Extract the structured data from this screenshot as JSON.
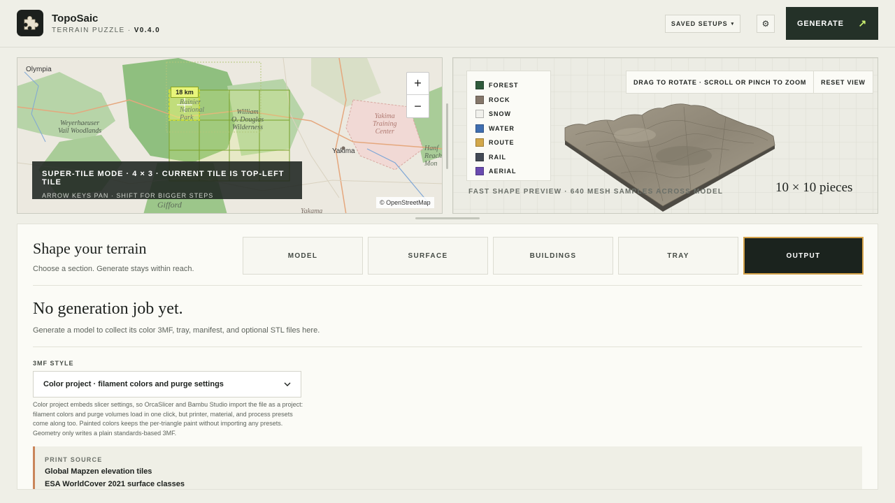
{
  "header": {
    "app_name": "TopoSaic",
    "app_subtitle": "TERRAIN PUZZLE ·",
    "version": "V0.4.0",
    "saved_setups_label": "SAVED SETUPS",
    "saved_setups_caret": "▾",
    "settings_icon": "gear-icon",
    "settings_glyph": "⚙",
    "generate_label": "GENERATE",
    "generate_arrow": "↗"
  },
  "map": {
    "zoom_in": "+",
    "zoom_out": "−",
    "scale_label": "18 km",
    "mode_title": "SUPER-TILE MODE · 4 × 3 · CURRENT TILE IS TOP-LEFT TILE",
    "mode_hint": "ARROW KEYS PAN · SHIFT FOR BIGGER STEPS",
    "attribution": "© OpenStreetMap",
    "labels": {
      "olympia": "Olympia",
      "weyerhaeuser": "Weyerhaeuser\nVail Woodlands",
      "william_douglas": "William\nO. Douglas\nWilderness",
      "rainier": "Rainier\nNational\nPark",
      "yakima_training": "Yakima\nTraining\nCenter",
      "yakima": "Yakima",
      "gifford": "Gifford",
      "yakama": "Yakama",
      "hanford": "Hanf\nReach N\nMon"
    }
  },
  "preview": {
    "legend": [
      {
        "label": "FOREST",
        "color": "#2f5a3b"
      },
      {
        "label": "ROCK",
        "color": "#85776a"
      },
      {
        "label": "SNOW",
        "color": "#f1f1ec"
      },
      {
        "label": "WATER",
        "color": "#3f6eb0"
      },
      {
        "label": "ROUTE",
        "color": "#d3a84a"
      },
      {
        "label": "RAIL",
        "color": "#434a55"
      },
      {
        "label": "AERIAL",
        "color": "#6a4bb0"
      }
    ],
    "view_hint": "DRAG TO ROTATE · SCROLL OR PINCH TO ZOOM",
    "reset_view": "RESET VIEW",
    "note": "FAST SHAPE PREVIEW · 640 MESH SAMPLES ACROSS MODEL",
    "pieces": "10 × 10 pieces"
  },
  "shape": {
    "title": "Shape your terrain",
    "subtitle": "Choose a section. Generate stays within reach.",
    "tabs": [
      "MODEL",
      "SURFACE",
      "BUILDINGS",
      "TRAY",
      "OUTPUT"
    ],
    "active_tab": "OUTPUT"
  },
  "output": {
    "heading": "No generation job yet.",
    "subheading": "Generate a model to collect its color 3MF, tray, manifest, and optional STL files here.",
    "style_label": "3MF STYLE",
    "style_value": "Color project · filament colors and purge settings",
    "style_description": "Color project embeds slicer settings, so OrcaSlicer and Bambu Studio import the file as a project: filament colors and purge volumes load in one click, but printer, material, and process presets come along too. Painted colors keeps the per-triangle paint without importing any presets. Geometry only writes a plain standards-based 3MF.",
    "print_source_label": "PRINT SOURCE",
    "print_sources": [
      "Global Mapzen elevation tiles",
      "ESA WorldCover 2021 surface classes"
    ]
  },
  "colors": {
    "accent_dark": "#243128",
    "accent_lime": "#c9ee6f",
    "active_tab_border": "#d4a24a",
    "print_source_border": "#c9855a"
  }
}
